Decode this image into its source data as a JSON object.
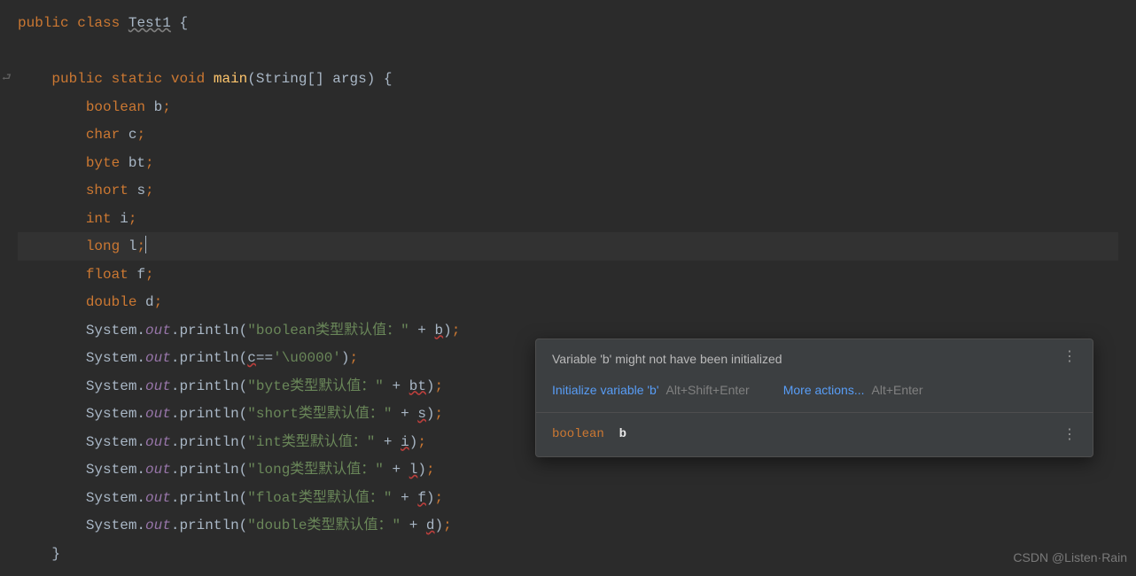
{
  "code": {
    "class_decl": {
      "public": "public",
      "class": "class",
      "name": "Test1",
      "brace": " {"
    },
    "main_sig": {
      "indent": "    ",
      "public": "public",
      "static": "static",
      "void": "void",
      "name": "main",
      "params": "(String[] args) {"
    },
    "decls": [
      {
        "indent": "        ",
        "type": "boolean",
        "var": "b",
        "semi": ";"
      },
      {
        "indent": "        ",
        "type": "char",
        "var": "c",
        "semi": ";"
      },
      {
        "indent": "        ",
        "type": "byte",
        "var": "bt",
        "semi": ";"
      },
      {
        "indent": "        ",
        "type": "short",
        "var": "s",
        "semi": ";"
      },
      {
        "indent": "        ",
        "type": "int",
        "var": "i",
        "semi": ";"
      },
      {
        "indent": "        ",
        "type": "long",
        "var": "l",
        "semi": ";"
      },
      {
        "indent": "        ",
        "type": "float",
        "var": "f",
        "semi": ";"
      },
      {
        "indent": "        ",
        "type": "double",
        "var": "d",
        "semi": ";"
      }
    ],
    "prints": [
      {
        "indent": "        ",
        "sys": "System",
        "dot1": ".",
        "out": "out",
        "dot2": ".",
        "method": "println",
        "open": "(",
        "str": "\"boolean类型默认值：\"",
        "plus": " + ",
        "var": "b",
        "close": ")",
        "semi": ";"
      },
      {
        "indent": "        ",
        "sys": "System",
        "dot1": ".",
        "out": "out",
        "dot2": ".",
        "method": "println",
        "open": "(",
        "expr_var": "c",
        "eq": "==",
        "chr": "'\\u0000'",
        "close": ")",
        "semi": ";"
      },
      {
        "indent": "        ",
        "sys": "System",
        "dot1": ".",
        "out": "out",
        "dot2": ".",
        "method": "println",
        "open": "(",
        "str": "\"byte类型默认值：\"",
        "plus": " + ",
        "var": "bt",
        "close": ")",
        "semi": ";"
      },
      {
        "indent": "        ",
        "sys": "System",
        "dot1": ".",
        "out": "out",
        "dot2": ".",
        "method": "println",
        "open": "(",
        "str": "\"short类型默认值：\"",
        "plus": " + ",
        "var": "s",
        "close": ")",
        "semi": ";"
      },
      {
        "indent": "        ",
        "sys": "System",
        "dot1": ".",
        "out": "out",
        "dot2": ".",
        "method": "println",
        "open": "(",
        "str": "\"int类型默认值：\"",
        "plus": " + ",
        "var": "i",
        "close": ")",
        "semi": ";"
      },
      {
        "indent": "        ",
        "sys": "System",
        "dot1": ".",
        "out": "out",
        "dot2": ".",
        "method": "println",
        "open": "(",
        "str": "\"long类型默认值：\"",
        "plus": " + ",
        "var": "l",
        "close": ")",
        "semi": ";"
      },
      {
        "indent": "        ",
        "sys": "System",
        "dot1": ".",
        "out": "out",
        "dot2": ".",
        "method": "println",
        "open": "(",
        "str": "\"float类型默认值：\"",
        "plus": " + ",
        "var": "f",
        "close": ")",
        "semi": ";"
      },
      {
        "indent": "        ",
        "sys": "System",
        "dot1": ".",
        "out": "out",
        "dot2": ".",
        "method": "println",
        "open": "(",
        "str": "\"double类型默认值：\"",
        "plus": " + ",
        "var": "d",
        "close": ")",
        "semi": ";"
      }
    ],
    "close_method": {
      "indent": "    ",
      "brace": "}"
    }
  },
  "tooltip": {
    "message": "Variable 'b' might not have been initialized",
    "fix_label": "Initialize variable 'b'",
    "fix_shortcut": "Alt+Shift+Enter",
    "more_label": "More actions...",
    "more_shortcut": "Alt+Enter",
    "doc_type": "boolean",
    "doc_var": "b"
  },
  "watermark": "CSDN @Listen·Rain"
}
